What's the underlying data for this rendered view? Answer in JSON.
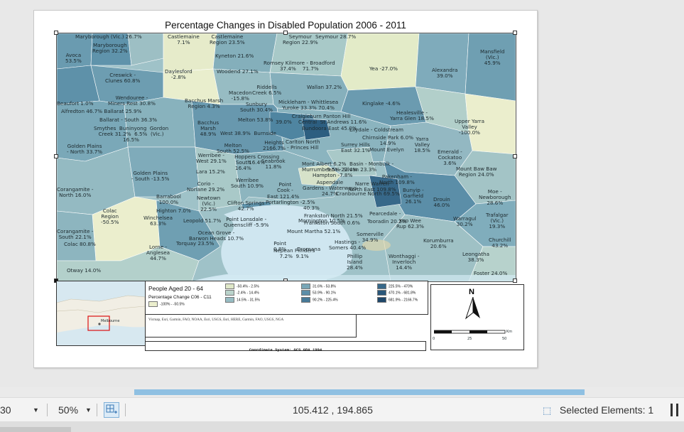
{
  "layout": {
    "title": "Percentage Changes in Disabled Population 2006 - 2011",
    "legend": {
      "title": "People Aged 20 - 64",
      "subtitle": "Percentage Change C06 - C11",
      "items": [
        {
          "label": "-100% - -50.5%",
          "color": "#ebeecd"
        },
        {
          "label": "-50.4% - 2.5%",
          "color": "#dfe7c8"
        },
        {
          "label": "-2.4% - 14.4%",
          "color": "#bad3cb"
        },
        {
          "label": "14.5% - 31.5%",
          "color": "#97bcc3"
        },
        {
          "label": "31.6% - 53.8%",
          "color": "#78a6b6"
        },
        {
          "label": "53.9% - 90.1%",
          "color": "#5c8ea8"
        },
        {
          "label": "90.2% - 225.4%",
          "color": "#477a98"
        },
        {
          "label": "225.5% - 470%",
          "color": "#376889"
        },
        {
          "label": "470.1% - 681.8%",
          "color": "#2a577a"
        },
        {
          "label": "681.9% - 2166.7%",
          "color": "#1f476a"
        }
      ]
    },
    "credits": "Vicmap, Esri, Garmin, FAO, NOAA, Esri, USGS, Esri, HERE, Garmin, FAO, USGS, NGA",
    "coordinate_system": "Coordinate System: GCS GDA 1994",
    "north_label": "N",
    "scale": {
      "zero": "0",
      "mid": "25",
      "max": "50",
      "unit": "Km"
    },
    "inset_label": "Melbourne"
  },
  "map_labels": [
    "Maryborough (Vic.) 26.7%",
    "Castlemaine\n7.1%",
    "Castlemaine\nRegion 23.5%",
    "Seymour\nRegion 22.9%",
    "Seymour 28.7%",
    "Maryborough\nRegion 32.2%",
    "Avoca\n53.5%",
    "Kyneton 21.6%",
    "Mansfield\n(Vic.)\n45.9%",
    "Romsey Kilmore - Broadford\n37.4%    71.7%",
    "Daylesford\n-2.8%",
    "Woodend 27.1%",
    "Yea -27.0%",
    "Alexandra\n39.0%",
    "Creswick -\nClunes 60.8%",
    "Riddells\nCreek 6.5%",
    "Wallan 37.2%",
    "Macedon\n-15.8%",
    "Wendouree -\nMiners Rest 30.8%",
    "Beaufort 1.0%",
    "Alfredton 46.7% Ballarat 25.9%",
    "Ballarat - South 36.3%",
    "Bacchus Marsh\nRegion 4.3%",
    "Sunbury\nSouth 30.4%",
    "Mickleham - Whittlesea\nYuroke 33.3% 70.4%",
    "Kinglake -4.6%",
    "Craigieburn Panton Hill\n39.0%    Central  St Andrews 11.6%",
    "Healesville -\nYarra Glen 18.5%",
    "Smythes  Buninyong  Gordon\nCreek 31.2%  6.5%  (Vic.)\n16.5%",
    "Bacchus\nMarsh\n48.9%",
    "Melton 53.8%",
    "West 38.9%  Burnside",
    "Bundoora East 45.0%",
    "Lilydale - Coldstream",
    "Chirnside Park 6.0%\n14.9%",
    "Upper Yarra\nValley\n-100.0%",
    "Golden Plains\n- North 33.7%",
    "Melton\nSouth 52.5%",
    "Hoppers Crossing\n16.4%",
    "Heights\n2166.7%",
    "Carlton North\n- Princes Hill",
    "Surrey Hills\nEast 32.1%",
    "Mount Evelyn",
    "Yarra\nValley\n18.5%",
    "Emerald -\nCockatoo\n3.6%",
    "Werribee -\nWest 29.1%",
    "South\n16.4%",
    "Seabrook\n11.8%",
    "Mont Albert 6.2%  Basin - Monbulk -\n     5.5%  Silvan 23.3%",
    "Mount Baw Baw\nRegion 24.0%",
    "Lara 15.2%",
    "Golden Plains\n- South -13.5%",
    "Murrumbeena -22.4%",
    "Hampton -7.8%",
    "Narre Warren\nNorth East 109.8%",
    "Pakenham -\nNorth 109.8%",
    "Werribee\nSouth 10.9%",
    "Point\nCook -",
    "Aspendale\nGardens - Waterways\n24.7%",
    "Corio -\nNorlane 29.2%",
    "East 121.4%",
    "Portarlington -2.5%",
    "Cranbourne North 69.5%",
    "Bunyip -\nGarfield\n26.1%",
    "Drouin\n46.0%",
    "Moe -\nNewborough\n28.6%",
    "Corangamite -\nNorth 16.0%",
    "Barrabool\n100.0%",
    "Newtown\n(Vic.)\n22.5%",
    "Clifton Springs\n42.7%",
    "40.3%",
    "Frankston North 21.5%",
    "Frankston South 0.6%",
    "Pearcedale -",
    "Colac\nRegion\n-50.5%",
    "Highton 7.0%",
    "Winchelsea\n63.3%",
    "Leopold 51.7%",
    "Point Lonsdale -\nQueenscliff -5.9%",
    "Mornington 10.5%",
    "Tooradin 20.2%",
    "Koo Wee\nRup 62.3%",
    "Warragul\n30.2%",
    "Trafalgar\n(Vic.)\n19.3%",
    "Corangamite -\nSouth 22.1%",
    "Ocean Grove -\nBarwon Heads 10.7%",
    "Mount Martha 52.1%",
    "Somerville\n34.9%",
    "Korumburra\n20.6%",
    "Churchill\n43.2%",
    "Colac 80.8%",
    "Torquay 23.5%",
    "Point\n0.8%",
    "Dromana",
    "Hastings -\nSomers 40.4%",
    "Lorne -\nAnglesea\n44.7%",
    "Nepean Flinders\n7.2%  9.1%",
    "Phillip\nIsland\n28.4%",
    "Wonthaggi -\nInverloch\n14.4%",
    "Leongatha\n38.3%",
    "Otway 14.0%",
    "Foster 24.0%"
  ],
  "statusbar": {
    "scale_value": "30",
    "zoom": "50%",
    "coordinates": "105.412 , 194.865",
    "selected": "Selected Elements: 1"
  }
}
